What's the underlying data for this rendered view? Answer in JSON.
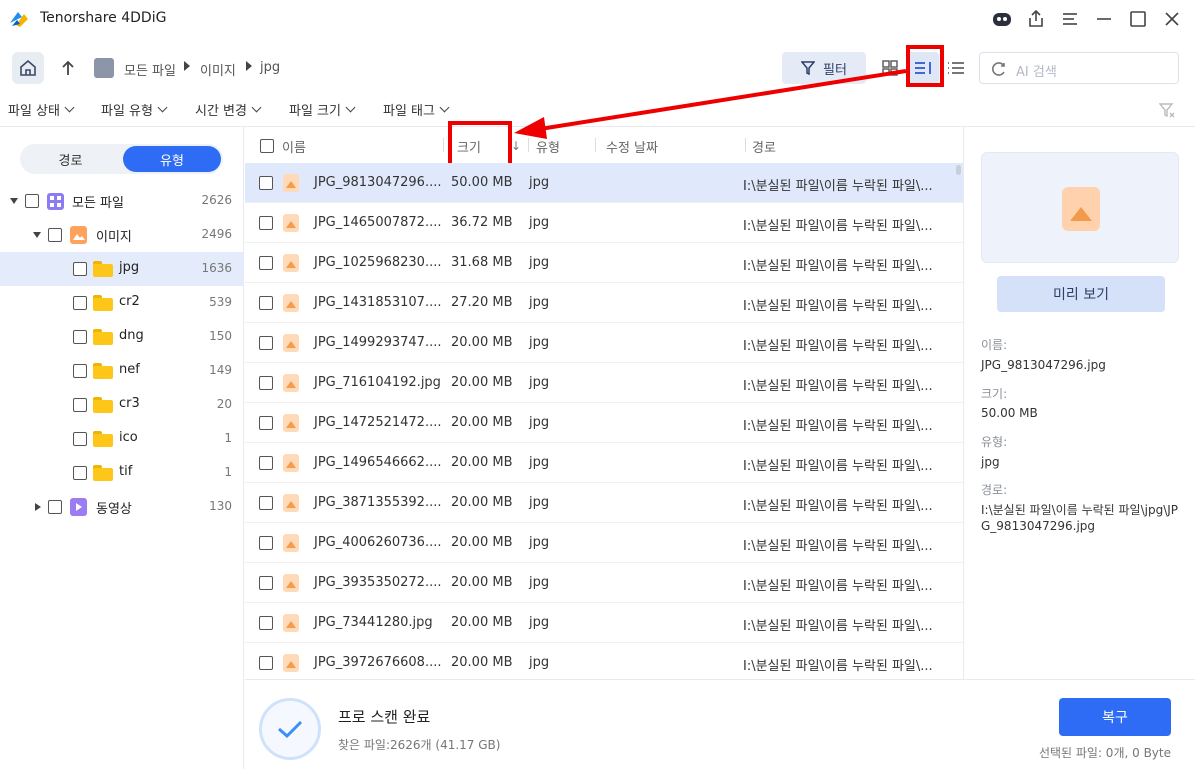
{
  "app": {
    "title": "Tenorshare 4DDiG"
  },
  "breadcrumb": {
    "items": [
      "모든 파일",
      "이미지",
      "jpg"
    ]
  },
  "toolbar": {
    "filter_label": "필터",
    "search_placeholder": "AI 검색"
  },
  "filters": [
    "파일 상태",
    "파일 유형",
    "시간 변경",
    "파일 크기",
    "파일 태그"
  ],
  "sidebar": {
    "toggle": {
      "left": "경로",
      "right": "유형"
    },
    "tree": [
      {
        "label": "모든 파일",
        "count": "2626"
      },
      {
        "label": "이미지",
        "count": "2496"
      },
      {
        "label": "jpg",
        "count": "1636"
      },
      {
        "label": "cr2",
        "count": "539"
      },
      {
        "label": "dng",
        "count": "150"
      },
      {
        "label": "nef",
        "count": "149"
      },
      {
        "label": "cr3",
        "count": "20"
      },
      {
        "label": "ico",
        "count": "1"
      },
      {
        "label": "tif",
        "count": "1"
      },
      {
        "label": "동영상",
        "count": "130"
      }
    ]
  },
  "table": {
    "headers": {
      "name": "이름",
      "size": "크기",
      "type": "유형",
      "modified": "수정 날짜",
      "path": "경로"
    },
    "rows": [
      {
        "name": "JPG_9813047296....",
        "size": "50.00 MB",
        "type": "jpg",
        "path": "I:\\분실된 파일\\이름 누락된 파일\\..."
      },
      {
        "name": "JPG_1465007872....",
        "size": "36.72 MB",
        "type": "jpg",
        "path": "I:\\분실된 파일\\이름 누락된 파일\\..."
      },
      {
        "name": "JPG_1025968230....",
        "size": "31.68 MB",
        "type": "jpg",
        "path": "I:\\분실된 파일\\이름 누락된 파일\\..."
      },
      {
        "name": "JPG_1431853107....",
        "size": "27.20 MB",
        "type": "jpg",
        "path": "I:\\분실된 파일\\이름 누락된 파일\\..."
      },
      {
        "name": "JPG_1499293747....",
        "size": "20.00 MB",
        "type": "jpg",
        "path": "I:\\분실된 파일\\이름 누락된 파일\\..."
      },
      {
        "name": "JPG_716104192.jpg",
        "size": "20.00 MB",
        "type": "jpg",
        "path": "I:\\분실된 파일\\이름 누락된 파일\\..."
      },
      {
        "name": "JPG_1472521472....",
        "size": "20.00 MB",
        "type": "jpg",
        "path": "I:\\분실된 파일\\이름 누락된 파일\\..."
      },
      {
        "name": "JPG_1496546662....",
        "size": "20.00 MB",
        "type": "jpg",
        "path": "I:\\분실된 파일\\이름 누락된 파일\\..."
      },
      {
        "name": "JPG_3871355392....",
        "size": "20.00 MB",
        "type": "jpg",
        "path": "I:\\분실된 파일\\이름 누락된 파일\\..."
      },
      {
        "name": "JPG_4006260736....",
        "size": "20.00 MB",
        "type": "jpg",
        "path": "I:\\분실된 파일\\이름 누락된 파일\\..."
      },
      {
        "name": "JPG_3935350272....",
        "size": "20.00 MB",
        "type": "jpg",
        "path": "I:\\분실된 파일\\이름 누락된 파일\\..."
      },
      {
        "name": "JPG_73441280.jpg",
        "size": "20.00 MB",
        "type": "jpg",
        "path": "I:\\분실된 파일\\이름 누락된 파일\\..."
      },
      {
        "name": "JPG_3972676608....",
        "size": "20.00 MB",
        "type": "jpg",
        "path": "I:\\분실된 파일\\이름 누락된 파일\\..."
      }
    ]
  },
  "preview": {
    "button": "미리 보기",
    "name_label": "이름:",
    "name_value": "JPG_9813047296.jpg",
    "size_label": "크기:",
    "size_value": "50.00 MB",
    "type_label": "유형:",
    "type_value": "jpg",
    "path_label": "경로:",
    "path_value": "I:\\분실된 파일\\이름 누락된 파일\\jpg\\JPG_9813047296.jpg"
  },
  "status": {
    "title": "프로 스캔 완료",
    "found": "찾은 파일:2626개 (41.17 GB)",
    "recover_button": "복구",
    "selected": "선택된 파일: 0개, 0 Byte"
  },
  "colors": {
    "accent": "#2f6cf6",
    "annotation": "#e00000",
    "selected_row": "#e0e8fb"
  }
}
